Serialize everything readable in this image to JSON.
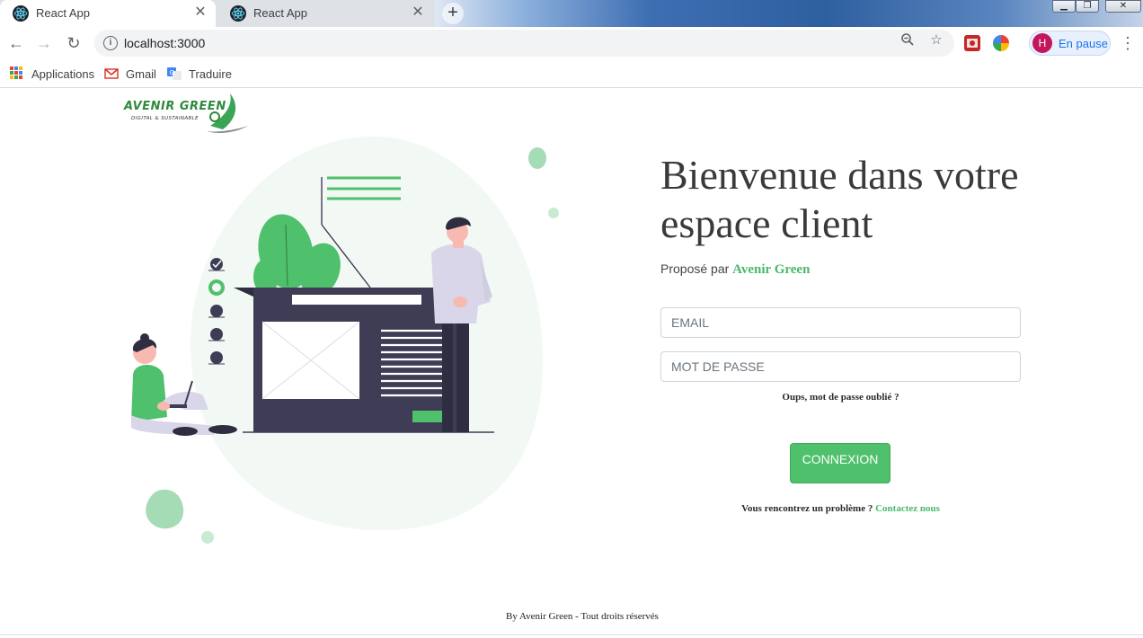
{
  "browser": {
    "tabs": [
      {
        "title": "React App",
        "active": true
      },
      {
        "title": "React App",
        "active": false
      }
    ],
    "url": "localhost:3000",
    "profile": {
      "initial": "H",
      "label": "En pause"
    },
    "bookmarks": [
      {
        "label": "Applications",
        "icon": "apps-grid-icon"
      },
      {
        "label": "Gmail",
        "icon": "gmail-icon"
      },
      {
        "label": "Traduire",
        "icon": "translate-icon"
      }
    ]
  },
  "page": {
    "title": "Bienvenue dans votre espace client",
    "subtitle_prefix": "Proposé par",
    "brand": "Avenir Green",
    "logo": {
      "name": "AVENIR GREEN",
      "tagline": "DIGITAL & SUSTAINABLE"
    },
    "email_placeholder": "EMAIL",
    "password_placeholder": "MOT DE PASSE",
    "forgot_link": "Oups, mot de passe oublié ?",
    "login_button": "CONNEXION",
    "help_text": "Vous rencontrez un problème ?",
    "contact_link": "Contactez nous",
    "footer": "By Avenir Green - Tout droits réservés"
  },
  "colors": {
    "accent": "#4fc06c",
    "brand_green": "#49b86a",
    "illustration_dark": "#3f3d56",
    "blob_light": "#f2f9f4"
  }
}
